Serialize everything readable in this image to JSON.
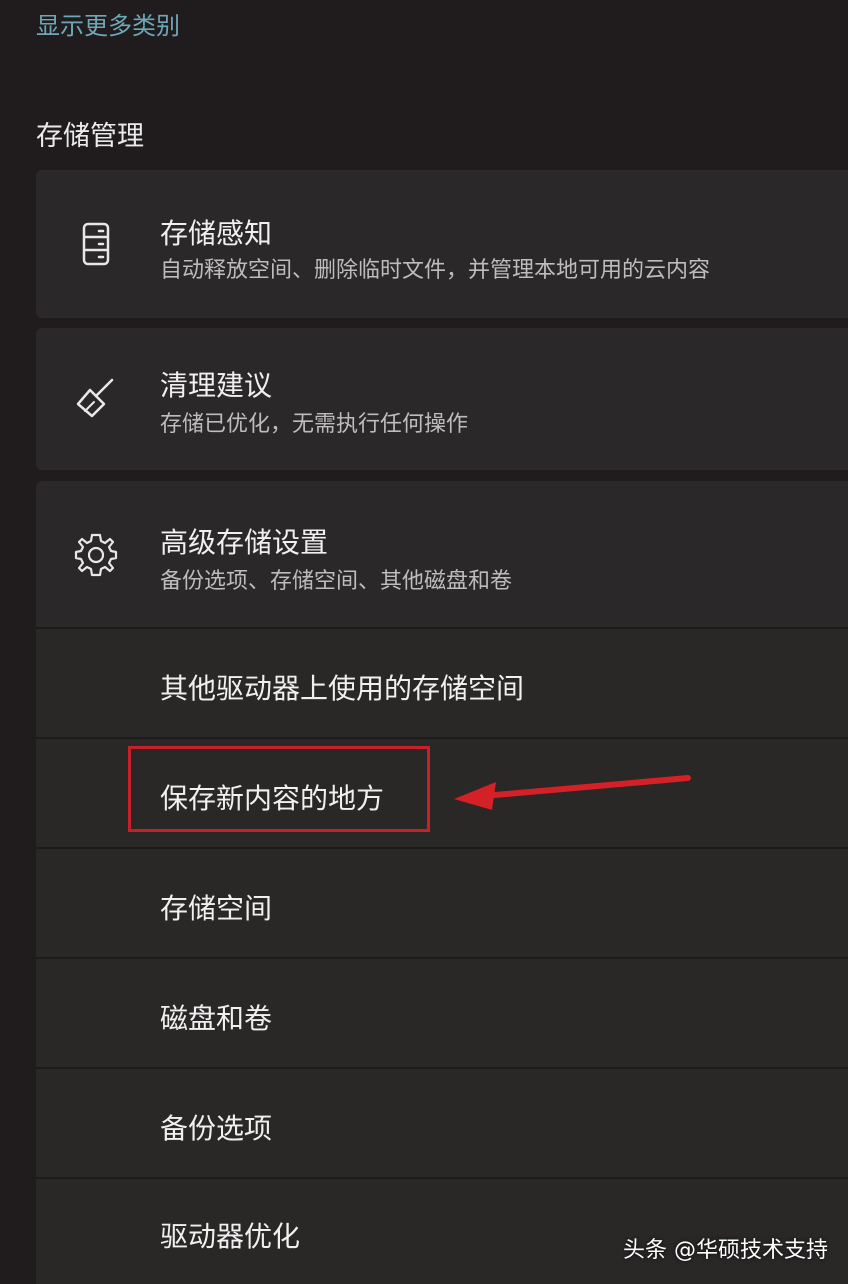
{
  "top_link": "显示更多类别",
  "section": {
    "title": "存储管理"
  },
  "cards": {
    "storage_sense": {
      "title": "存储感知",
      "subtitle": "自动释放空间、删除临时文件，并管理本地可用的云内容",
      "icon": "storage-drive-icon"
    },
    "cleanup": {
      "title": "清理建议",
      "subtitle": "存储已优化，无需执行任何操作",
      "icon": "broom-icon"
    },
    "advanced": {
      "title": "高级存储设置",
      "subtitle": "备份选项、存储空间、其他磁盘和卷",
      "icon": "gear-icon"
    }
  },
  "advanced_items": [
    {
      "label": "其他驱动器上使用的存储空间"
    },
    {
      "label": "保存新内容的地方"
    },
    {
      "label": "存储空间"
    },
    {
      "label": "磁盘和卷"
    },
    {
      "label": "备份选项"
    },
    {
      "label": "驱动器优化"
    }
  ],
  "annotation": {
    "highlight_color": "#c8202a",
    "arrow_color": "#d42027"
  },
  "colors": {
    "link": "#6ea8b8",
    "card_background": "#2b2829",
    "page_background": "#201c1d"
  },
  "watermark": "头条 @华硕技术支持"
}
